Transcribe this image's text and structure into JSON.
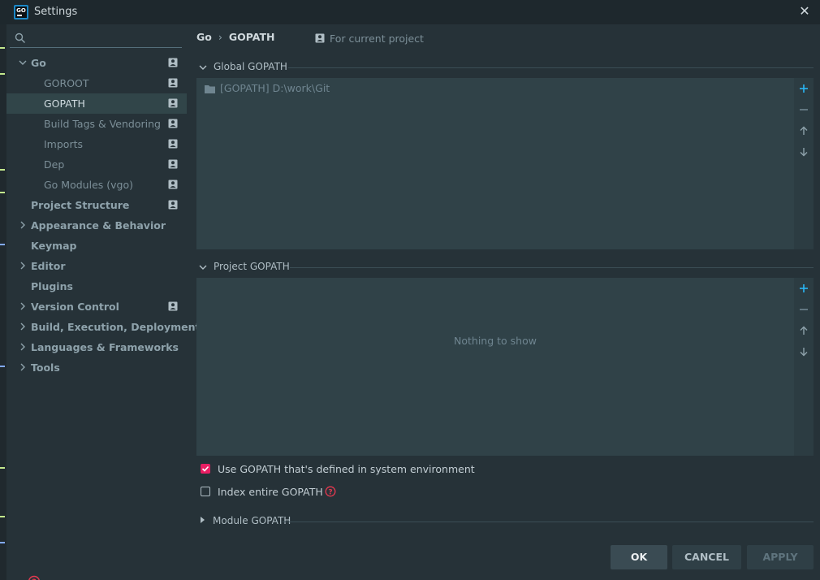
{
  "window": {
    "title": "Settings"
  },
  "sidebar": {
    "search_placeholder": "",
    "items": [
      {
        "label": "Go",
        "level": 0,
        "expanded": true,
        "project_icon": true
      },
      {
        "label": "GOROOT",
        "level": 1,
        "project_icon": true
      },
      {
        "label": "GOPATH",
        "level": 1,
        "selected": true,
        "project_icon": true
      },
      {
        "label": "Build Tags & Vendoring",
        "level": 1,
        "project_icon": true
      },
      {
        "label": "Imports",
        "level": 1,
        "project_icon": true
      },
      {
        "label": "Dep",
        "level": 1,
        "project_icon": true
      },
      {
        "label": "Go Modules (vgo)",
        "level": 1,
        "project_icon": true
      },
      {
        "label": "Project Structure",
        "level": 0,
        "project_icon": true
      },
      {
        "label": "Appearance & Behavior",
        "level": 0,
        "collapsible": true
      },
      {
        "label": "Keymap",
        "level": 0
      },
      {
        "label": "Editor",
        "level": 0,
        "collapsible": true
      },
      {
        "label": "Plugins",
        "level": 0
      },
      {
        "label": "Version Control",
        "level": 0,
        "collapsible": true,
        "project_icon": true
      },
      {
        "label": "Build, Execution, Deployment",
        "level": 0,
        "collapsible": true
      },
      {
        "label": "Languages & Frameworks",
        "level": 0,
        "collapsible": true
      },
      {
        "label": "Tools",
        "level": 0,
        "collapsible": true
      }
    ]
  },
  "main": {
    "breadcrumb": {
      "parent": "Go",
      "separator": "›",
      "current": "GOPATH"
    },
    "for_current_project": "For current project",
    "global_gopath": {
      "title": "Global GOPATH",
      "entries": [
        {
          "tag": "[GOPATH]",
          "path": "D:\\work\\Git"
        }
      ]
    },
    "project_gopath": {
      "title": "Project GOPATH",
      "empty_text": "Nothing to show"
    },
    "options": {
      "use_system_gopath": {
        "label": "Use GOPATH that's defined in system environment",
        "checked": true
      },
      "index_entire_gopath": {
        "label": "Index entire GOPATH",
        "checked": false
      }
    },
    "module_gopath": {
      "title": "Module GOPATH"
    }
  },
  "buttons": {
    "ok": "OK",
    "cancel": "CANCEL",
    "apply": "APPLY"
  },
  "colors": {
    "background": "#263238",
    "selected": "#314549",
    "list_bg": "#304248",
    "accent_add": "#29b6f6",
    "checkbox_checked": "#e91e63",
    "help": "#e53950"
  }
}
